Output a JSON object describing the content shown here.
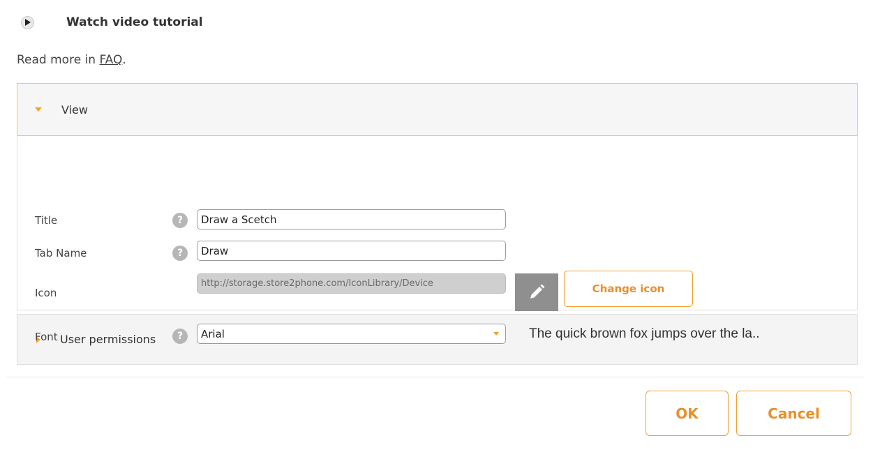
{
  "tutorial": {
    "icon": "play-circle-icon",
    "label": "Watch video tutorial"
  },
  "faq": {
    "prefix": "Read more in ",
    "link": "FAQ",
    "suffix": "."
  },
  "view_panel": {
    "title": "View",
    "expanded": true,
    "fields": {
      "title": {
        "label": "Title",
        "value": "Draw a Scetch"
      },
      "tab_name": {
        "label": "Tab Name",
        "value": "Draw"
      },
      "icon": {
        "label": "Icon",
        "value": "http://storage.store2phone.com/IconLibrary/Device",
        "change_label": "Change icon"
      },
      "font": {
        "label": "Font",
        "value": "Arial",
        "preview": "The quick brown fox jumps over the la.."
      }
    },
    "help_glyph": "?"
  },
  "permissions_panel": {
    "title": "User permissions",
    "expanded": false
  },
  "footer": {
    "ok_label": "OK",
    "cancel_label": "Cancel"
  },
  "colors": {
    "accent": "#f0a030",
    "header_border": "#f2c94c"
  }
}
